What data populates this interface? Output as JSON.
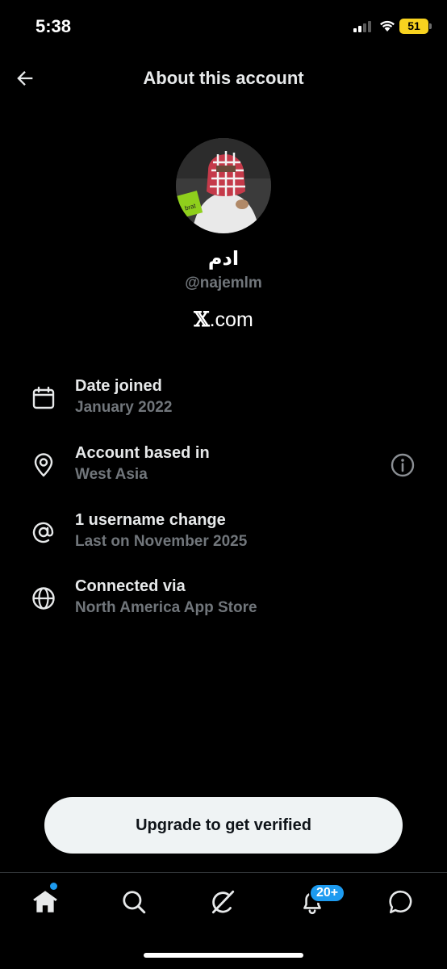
{
  "status_bar": {
    "time": "5:38",
    "battery_level": "51",
    "battery_color": "#f7d21f"
  },
  "header": {
    "title": "About this account",
    "back_icon": "arrow-left-icon"
  },
  "profile": {
    "display_name": "ادم",
    "handle": "@najemlm",
    "site_mark": "𝕏",
    "site_suffix": ".com"
  },
  "info_rows": [
    {
      "icon": "calendar-icon",
      "title": "Date joined",
      "subtitle": "January 2022"
    },
    {
      "icon": "location-pin-icon",
      "title": "Account based in",
      "subtitle": "West Asia",
      "trailing_icon": "info-icon"
    },
    {
      "icon": "at-sign-icon",
      "title": "1 username change",
      "subtitle": "Last on November 2025"
    },
    {
      "icon": "globe-icon",
      "title": "Connected via",
      "subtitle": "North America App Store"
    }
  ],
  "cta": {
    "label": "Upgrade to get verified"
  },
  "tab_bar": {
    "tabs": [
      "home-icon",
      "search-icon",
      "grok-icon",
      "notifications-bell-icon",
      "messages-icon"
    ],
    "notifications_badge": "20+",
    "accent_color": "#1d9bf0"
  },
  "colors": {
    "background": "#000000",
    "primary_text": "#e7e9ea",
    "secondary_text": "#71767b"
  }
}
